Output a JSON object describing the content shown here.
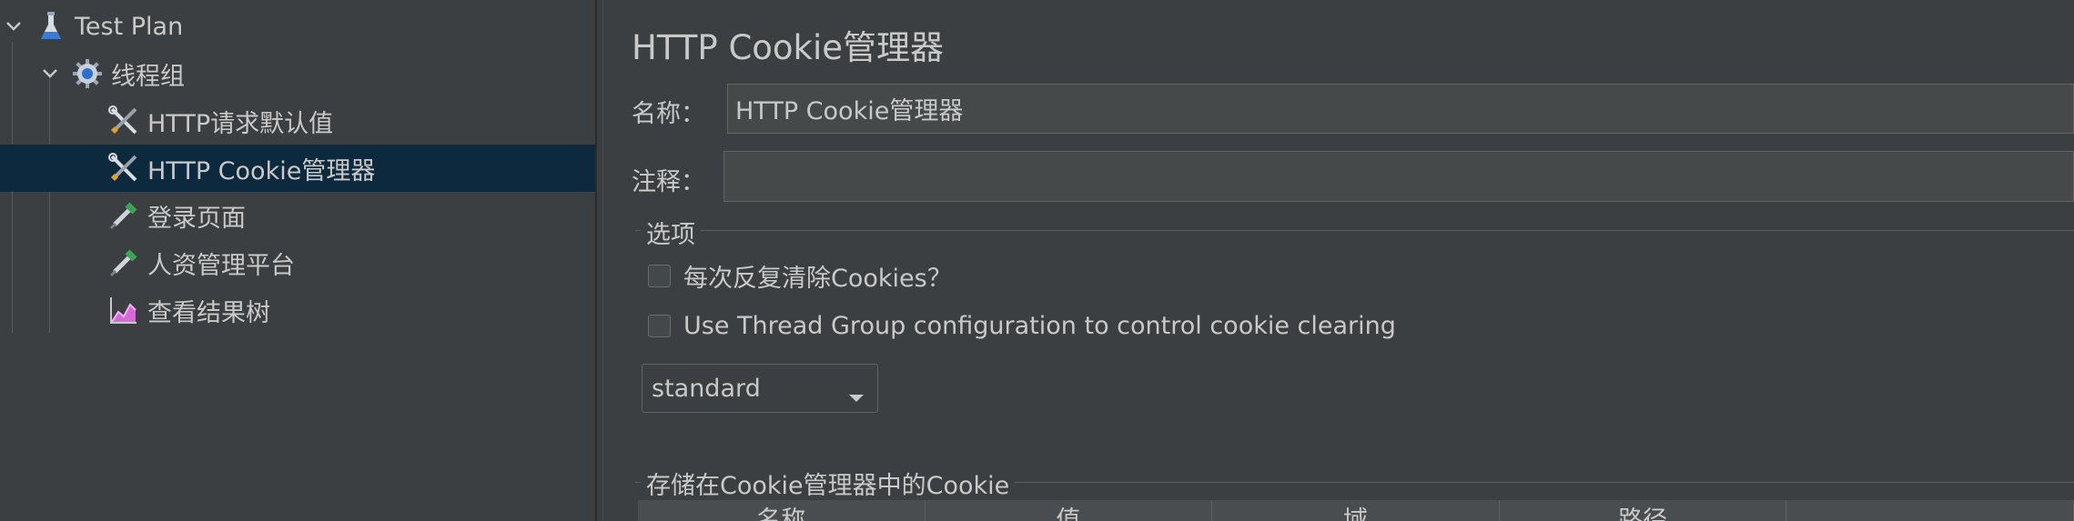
{
  "tree": {
    "items": [
      {
        "label": "Test Plan",
        "icon": "flask-icon",
        "expanded": true
      },
      {
        "label": "线程组",
        "icon": "gear-icon",
        "expanded": true
      },
      {
        "label": "HTTP请求默认值",
        "icon": "wrench-screwdriver-icon"
      },
      {
        "label": "HTTP Cookie管理器",
        "icon": "wrench-screwdriver-icon",
        "selected": true
      },
      {
        "label": "登录页面",
        "icon": "pipette-icon"
      },
      {
        "label": "人资管理平台",
        "icon": "pipette-icon"
      },
      {
        "label": "查看结果树",
        "icon": "chart-icon"
      }
    ]
  },
  "panel": {
    "title": "HTTP Cookie管理器",
    "name_label": "名称：",
    "name_value": "HTTP Cookie管理器",
    "comment_label": "注释：",
    "comment_value": "",
    "options_title": "选项",
    "clear_each_iteration_label": "每次反复清除Cookies？",
    "clear_each_iteration_checked": false,
    "use_thread_group_label": "Use Thread Group configuration to control cookie clearing",
    "use_thread_group_checked": false,
    "cookie_policy": "standard",
    "stored_cookies_title": "存储在Cookie管理器中的Cookie",
    "table_headers": [
      "名称",
      "值",
      "域",
      "路径",
      ""
    ]
  },
  "colors": {
    "background": "#3c3f41",
    "selection": "#0d293e",
    "text": "#c9c9c9"
  }
}
